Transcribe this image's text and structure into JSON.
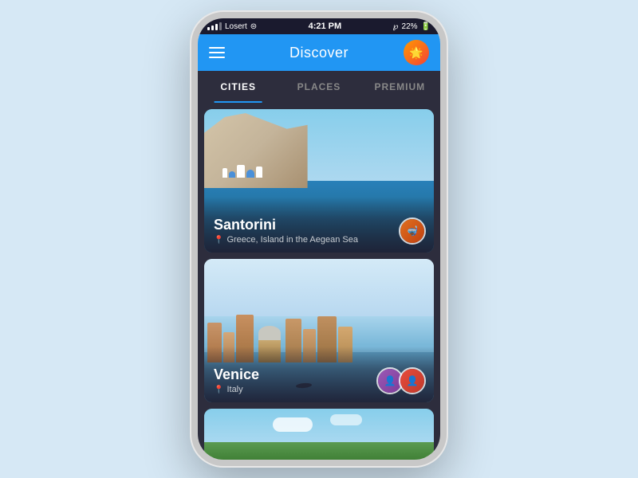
{
  "status_bar": {
    "carrier": "Losert",
    "time": "4:21 PM",
    "bluetooth": "22%"
  },
  "header": {
    "title": "Discover"
  },
  "tabs": [
    {
      "id": "cities",
      "label": "CITIES",
      "active": true
    },
    {
      "id": "places",
      "label": "PLACES",
      "active": false
    },
    {
      "id": "premium",
      "label": "PREMIUM",
      "active": false
    }
  ],
  "cards": [
    {
      "id": "santorini",
      "city": "Santorini",
      "location": "Greece, Island in the Aegean Sea",
      "avatars": [
        "🤿"
      ]
    },
    {
      "id": "venice",
      "city": "Venice",
      "location": "Italy",
      "avatars": [
        "👤",
        "👤"
      ]
    },
    {
      "id": "third",
      "city": "",
      "location": "",
      "avatars": []
    }
  ]
}
